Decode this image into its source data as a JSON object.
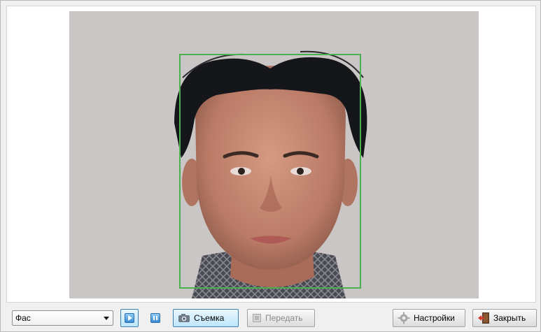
{
  "view": {
    "detection_box_color": "#4caf50",
    "background_color": "#cbc6c6"
  },
  "toolbar": {
    "pose_select": {
      "value": "Фас"
    },
    "play_button": {
      "icon": "play-icon"
    },
    "pause_button": {
      "icon": "pause-icon"
    },
    "capture_button": {
      "label": "Съемка",
      "icon": "camera-icon"
    },
    "send_button": {
      "label": "Передать",
      "icon": "send-icon",
      "enabled": false
    },
    "settings_button": {
      "label": "Настройки",
      "icon": "gear-icon"
    },
    "close_button": {
      "label": "Закрыть",
      "icon": "exit-door-icon"
    }
  }
}
